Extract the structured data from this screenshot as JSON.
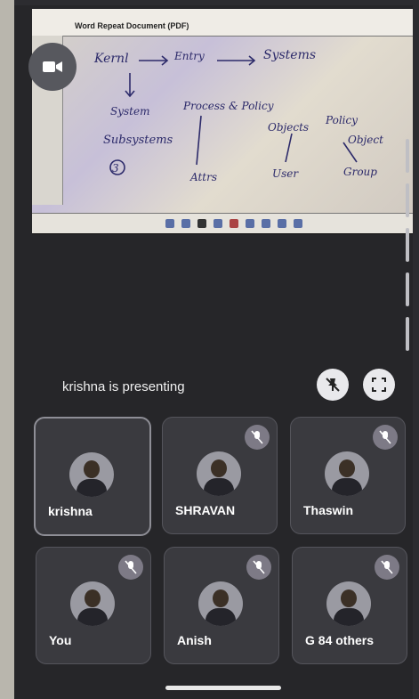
{
  "meeting": {
    "presenter_text": "krishna is presenting"
  },
  "presentation": {
    "doc_title": "Word Repeat Document (PDF)",
    "handwriting": {
      "kernel": "Kernl",
      "entry": "Entry",
      "systems": "Systems",
      "subsystem": "System",
      "process": "Process & Policy",
      "subsystems": "Subsystems",
      "objects": "Objects",
      "policy": "Policy",
      "object": "Object",
      "attrs": "Attrs",
      "user": "User",
      "group": "Group",
      "circle3": "3"
    }
  },
  "participants": [
    {
      "name": "krishna",
      "muted": false,
      "active": true
    },
    {
      "name": "SHRAVAN",
      "muted": true,
      "active": false
    },
    {
      "name": "Thaswin",
      "muted": true,
      "active": false
    },
    {
      "name": "You",
      "muted": true,
      "active": false
    },
    {
      "name": "Anish",
      "muted": true,
      "active": false
    },
    {
      "name": "G 84 others",
      "muted": true,
      "active": false
    }
  ],
  "icons": {
    "camera": "video-camera-icon",
    "unpin": "unpin-icon",
    "fullscreen": "fullscreen-icon",
    "mic_off": "mic-off-icon"
  }
}
